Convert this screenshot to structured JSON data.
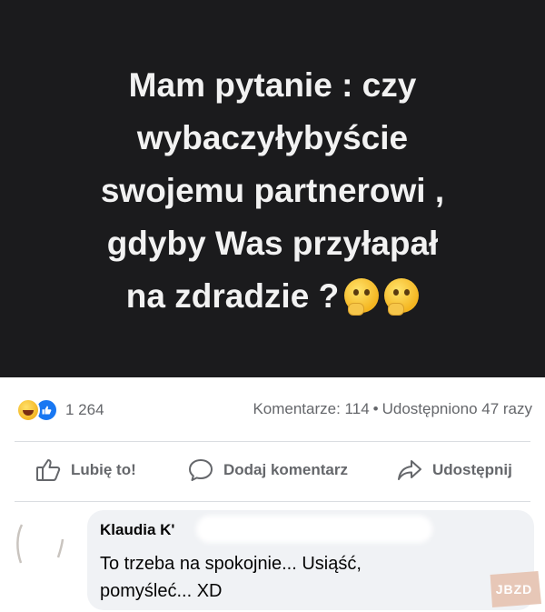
{
  "post": {
    "image_text_lines": [
      "Mam pytanie : czy",
      "wybaczyłybyście",
      "swojemu partnerowi ,",
      "gdyby Was przyłapał",
      "na zdradzie ?"
    ],
    "image_background": "#1b1b1d",
    "reactions": {
      "icons": [
        "haha-reaction-icon",
        "like-reaction-icon"
      ],
      "count": "1 264"
    },
    "comments_count_text": "Komentarze: 114",
    "shares_text": "Udostępniono 47 razy"
  },
  "actions": {
    "like_label": "Lubię to!",
    "comment_label": "Dodaj komentarz",
    "share_label": "Udostępnij"
  },
  "comment": {
    "author": "Klaudia K'",
    "text_line1": "To trzeba na spokojnie... Usiąść,",
    "text_line2": "pomyśleć... XD"
  },
  "watermark": {
    "text": "JBZD"
  },
  "colors": {
    "secondary_text": "#65676b",
    "like_blue": "#1877f2",
    "bubble_bg": "#f0f2f5"
  }
}
